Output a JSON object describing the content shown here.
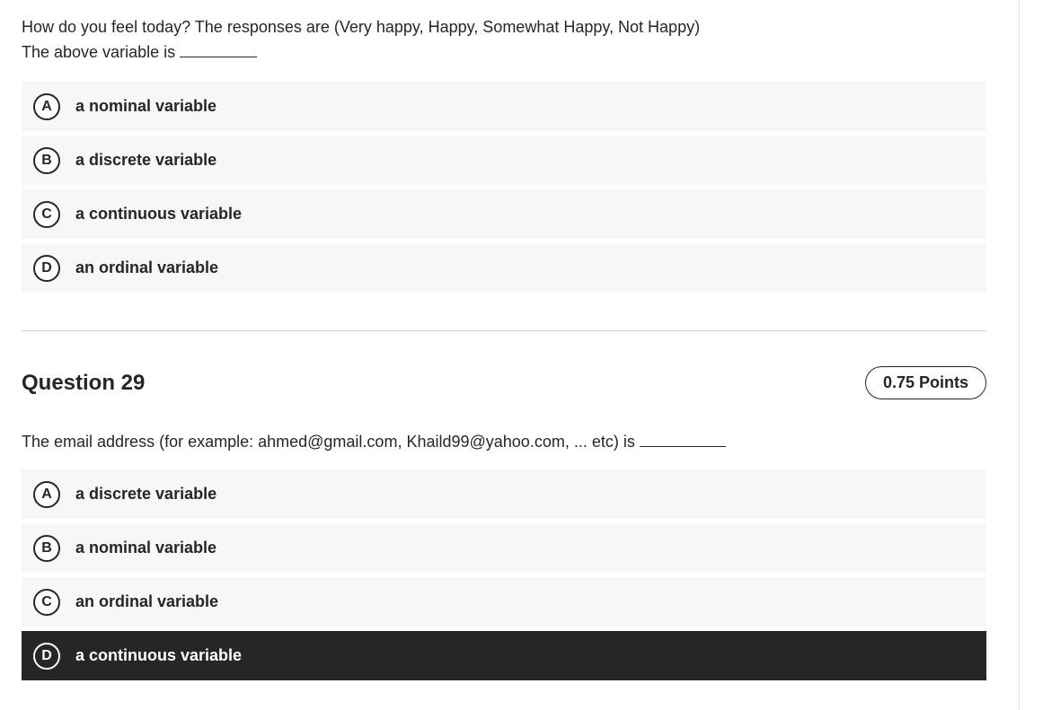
{
  "question_28": {
    "text_line1": "How do you feel today? The responses are (Very happy, Happy, Somewhat Happy, Not Happy)",
    "text_line2": "The above variable is",
    "options": [
      {
        "letter": "A",
        "label": "a nominal variable"
      },
      {
        "letter": "B",
        "label": "a discrete variable"
      },
      {
        "letter": "C",
        "label": "a continuous variable"
      },
      {
        "letter": "D",
        "label": "an ordinal variable"
      }
    ]
  },
  "question_29": {
    "title": "Question 29",
    "points": "0.75 Points",
    "text": "The email address (for example: ahmed@gmail.com, Khaild99@yahoo.com, ... etc) is",
    "options": [
      {
        "letter": "A",
        "label": "a discrete variable"
      },
      {
        "letter": "B",
        "label": "a nominal variable"
      },
      {
        "letter": "C",
        "label": "an ordinal variable"
      },
      {
        "letter": "D",
        "label": "a continuous variable",
        "selected": true
      }
    ]
  },
  "colors": {
    "selected_bg": "#262626",
    "option_bg": "#f7f7f7",
    "text": "#262626"
  }
}
